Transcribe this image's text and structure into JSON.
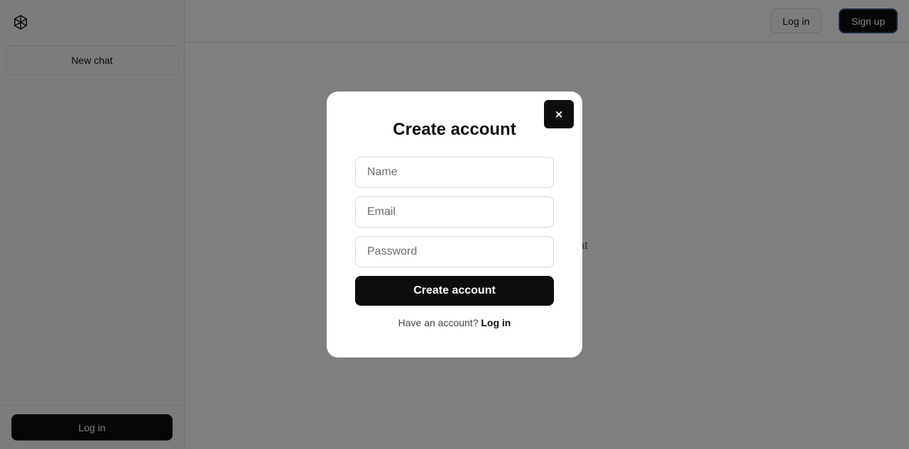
{
  "sidebar": {
    "logo_icon": "openai-logo-icon",
    "new_chat_label": "New chat",
    "login_label": "Log in"
  },
  "header": {
    "login_label": "Log in",
    "signup_label": "Sign up"
  },
  "main": {
    "empty_state_text": "Start a new chat"
  },
  "modal": {
    "close_label": "×",
    "title": "Create account",
    "name_placeholder": "Name",
    "email_placeholder": "Email",
    "password_placeholder": "Password",
    "submit_label": "Create account",
    "footer_prompt": "Have an account?",
    "footer_link": "Log in"
  },
  "colors": {
    "primary": "#0d0d0d",
    "overlay": "rgba(0,0,0,0.5)",
    "signup_focus_ring": "#2b4a80"
  }
}
